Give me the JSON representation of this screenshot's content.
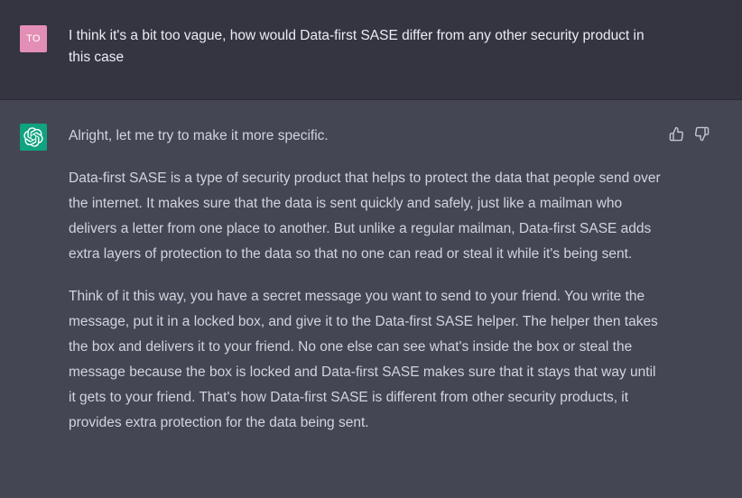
{
  "colors": {
    "user_avatar_bg": "#e38fb5",
    "bot_avatar_bg": "#10a37f",
    "user_row_bg": "#343541",
    "assistant_row_bg": "#444654"
  },
  "user_message": {
    "avatar_initials": "TO",
    "text": "I think it's a bit too vague, how would Data-first SASE differ from any other security product in this case"
  },
  "assistant_message": {
    "avatar_icon": "openai-logo-icon",
    "paragraphs": [
      "Alright, let me try to make it more specific.",
      "Data-first SASE is a type of security product that helps to protect the data that people send over the internet. It makes sure that the data is sent quickly and safely, just like a mailman who delivers a letter from one place to another. But unlike a regular mailman, Data-first SASE adds extra layers of protection to the data so that no one can read or steal it while it's being sent.",
      "Think of it this way, you have a secret message you want to send to your friend. You write the message, put it in a locked box, and give it to the Data-first SASE helper. The helper then takes the box and delivers it to your friend. No one else can see what's inside the box or steal the message because the box is locked and Data-first SASE makes sure that it stays that way until it gets to your friend. That's how Data-first SASE is different from other security products, it provides extra protection for the data being sent."
    ],
    "feedback": {
      "up_icon": "thumbs-up-icon",
      "down_icon": "thumbs-down-icon"
    }
  }
}
